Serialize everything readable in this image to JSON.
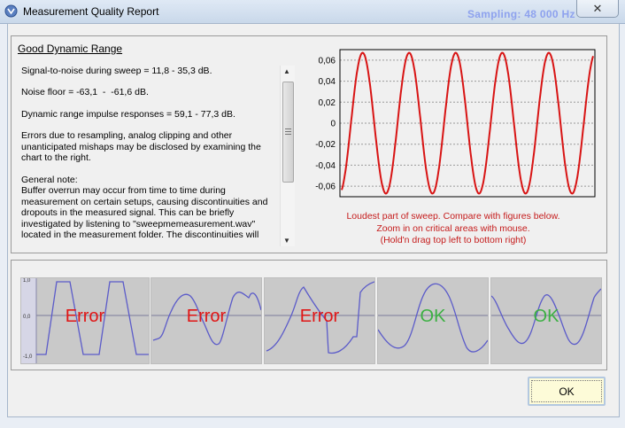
{
  "window": {
    "title": "Measurement Quality Report",
    "background_text": "Sampling: 48 000 Hz",
    "close_glyph": "✕"
  },
  "report": {
    "heading": "Good Dynamic Range",
    "paragraphs": [
      "Signal-to-noise during sweep = 11,8 - 35,3 dB.",
      "Noise floor = -63,1  -  -61,6 dB.",
      "Dynamic range impulse responses = 59,1 - 77,3 dB.",
      "Errors due to resampling, analog clipping and other unanticipated mishaps may be disclosed by examining the chart to the right.",
      "General note:\nBuffer overrun may occur from time to time during measurement on certain setups, causing discontinuities and dropouts in the measured signal. This can be briefly investigated by listening to \"sweepmemeasurement.wav\" located in the measurement folder. The discontinuities will"
    ]
  },
  "chart_data": {
    "type": "line",
    "ylim": [
      -0.07,
      0.07
    ],
    "yticks": [
      "0,06",
      "0,04",
      "0,02",
      "0",
      "-0,02",
      "-0,04",
      "-0,06"
    ],
    "ytick_values": [
      0.06,
      0.04,
      0.02,
      0,
      -0.02,
      -0.04,
      -0.06
    ],
    "grid": true,
    "series": [
      {
        "color": "#d81414",
        "amplitude": 0.067,
        "cycles": 5.4,
        "phase": -1.25
      }
    ]
  },
  "caption": {
    "line1": "Loudest part of sweep. Compare with figures below.",
    "line2": "Zoom in on critical areas with mouse.",
    "line3": "(Hold'n drag top left to bottom right)"
  },
  "examples": [
    {
      "label": "Error",
      "color": "#e01515",
      "axis": [
        "1,0",
        "0,0",
        "-1,0"
      ]
    },
    {
      "label": "Error",
      "color": "#e01515"
    },
    {
      "label": "Error",
      "color": "#e01515"
    },
    {
      "label": "OK",
      "color": "#3cb043"
    },
    {
      "label": "OK",
      "color": "#3cb043"
    }
  ],
  "footer": {
    "ok_label": "OK"
  }
}
